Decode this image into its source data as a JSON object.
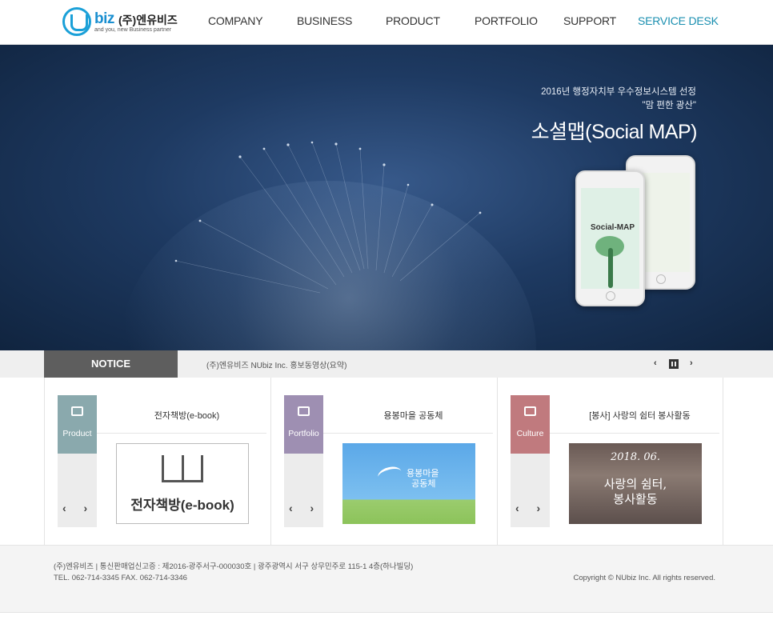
{
  "header": {
    "logo_biz": "biz",
    "logo_kor": "(주)엔유비즈",
    "logo_tagline": "and you, new Business partner",
    "nav": [
      "COMPANY",
      "BUSINESS",
      "PRODUCT",
      "PORTFOLIO",
      "SUPPORT",
      "SERVICE DESK"
    ],
    "active_nav": "SERVICE DESK"
  },
  "hero": {
    "line1": "2016년 행정자치부 우수정보시스템 선정",
    "line2": "\"맘 편한 광산\"",
    "title": "소셜맵(Social MAP)",
    "phone_label": "Social-MAP"
  },
  "notice": {
    "tab_label": "NOTICE",
    "text": "(주)엔유비즈 NUbiz Inc. 홍보동영상(요약)",
    "prev_icon": "‹",
    "next_icon": "›"
  },
  "cards": [
    {
      "category": "Product",
      "color": "#8aa9ad",
      "title": "전자책방(e-book)",
      "thumb_text": "전자책방(e-book)"
    },
    {
      "category": "Portfolio",
      "color": "#9e8fb2",
      "title": "용봉마을 공동체",
      "thumb_text": "용봉마을\n  공동체"
    },
    {
      "category": "Culture",
      "color": "#c07a7e",
      "title": "[봉사] 사랑의 쉼터 봉사활동",
      "thumb_date": "2018. 06.",
      "thumb_text": "사랑의 쉼터,\n봉사활동"
    }
  ],
  "card_arrows": "‹ ›",
  "footer": {
    "line1": "(주)엔유비즈   |   통신판매업신고증 : 제2016-광주서구-000030호   |   광주광역시 서구 상무민주로 115-1 4층(하나빌딩)",
    "line2": "TEL. 062-714-3345        FAX. 062-714-3346",
    "copyright": "Copyright © NUbiz Inc. All rights reserved."
  }
}
